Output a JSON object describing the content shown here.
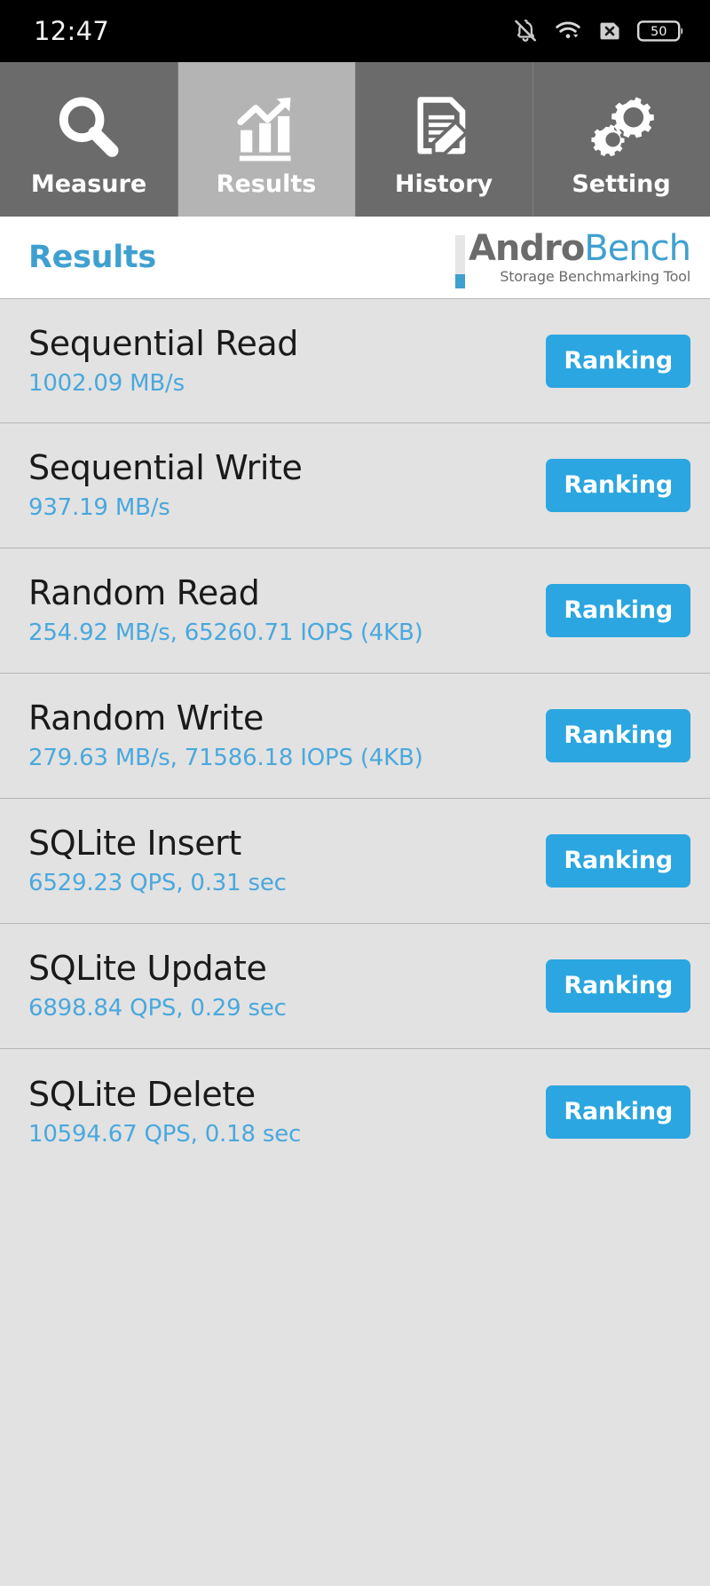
{
  "statusbar": {
    "time": "12:47",
    "icons": [
      "notifications-off-icon",
      "wifi-icon",
      "sim-error-icon",
      "battery-icon"
    ],
    "battery_level": "50"
  },
  "tabs": [
    {
      "label": "Measure",
      "icon": "magnifier-icon",
      "active": false
    },
    {
      "label": "Results",
      "icon": "bar-chart-trend-icon",
      "active": true
    },
    {
      "label": "History",
      "icon": "document-pencil-icon",
      "active": false
    },
    {
      "label": "Setting",
      "icon": "gears-icon",
      "active": false
    }
  ],
  "header": {
    "title": "Results",
    "brand_first": "Andro",
    "brand_second": "Bench",
    "tagline": "Storage Benchmarking Tool"
  },
  "colors": {
    "accent_blue": "#2ba6e0",
    "value_blue": "#4aa8dd",
    "title_blue": "#3fa0d0",
    "tab_inactive": "#6b6b6b",
    "tab_active": "#b4b4b4",
    "list_bg": "#e2e2e2"
  },
  "results": [
    {
      "name": "Sequential Read",
      "value": "1002.09 MB/s",
      "button": "Ranking"
    },
    {
      "name": "Sequential Write",
      "value": "937.19 MB/s",
      "button": "Ranking"
    },
    {
      "name": "Random Read",
      "value": "254.92 MB/s, 65260.71 IOPS (4KB)",
      "button": "Ranking"
    },
    {
      "name": "Random Write",
      "value": "279.63 MB/s, 71586.18 IOPS (4KB)",
      "button": "Ranking"
    },
    {
      "name": "SQLite Insert",
      "value": "6529.23 QPS, 0.31 sec",
      "button": "Ranking"
    },
    {
      "name": "SQLite Update",
      "value": "6898.84 QPS, 0.29 sec",
      "button": "Ranking"
    },
    {
      "name": "SQLite Delete",
      "value": "10594.67 QPS, 0.18 sec",
      "button": "Ranking"
    }
  ]
}
